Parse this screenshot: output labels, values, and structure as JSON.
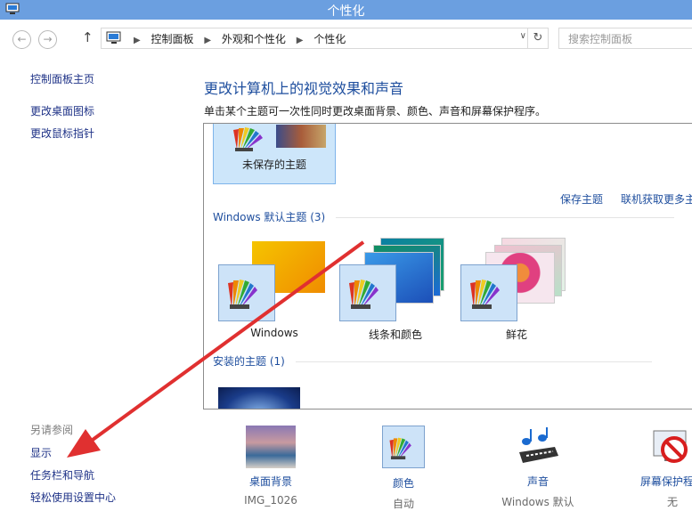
{
  "window": {
    "title": "个性化"
  },
  "nav": {
    "back": "←",
    "forward": "→",
    "up": "↑",
    "breadcrumbs": [
      "控制面板",
      "外观和个性化",
      "个性化"
    ],
    "dropdown": "∨",
    "refresh": "↻",
    "search_placeholder": "搜索控制面板"
  },
  "sidebar": {
    "links": [
      "控制面板主页",
      "更改桌面图标",
      "更改鼠标指针"
    ],
    "see_also_label": "另请参阅",
    "see_also": [
      "显示",
      "任务栏和导航",
      "轻松使用设置中心"
    ]
  },
  "main": {
    "heading": "更改计算机上的视觉效果和声音",
    "description": "单击某个主题可一次性同时更改桌面背景、颜色、声音和屏幕保护程序。",
    "unsaved_theme": "未保存的主题",
    "actions": [
      "保存主题",
      "联机获取更多主题"
    ],
    "default_group": "Windows 默认主题 (3)",
    "default_themes": [
      "Windows",
      "线条和颜色",
      "鲜花"
    ],
    "installed_group": "安装的主题 (1)"
  },
  "bottom": [
    {
      "label": "桌面背景",
      "value": "IMG_1026"
    },
    {
      "label": "颜色",
      "value": "自动"
    },
    {
      "label": "声音",
      "value": "Windows 默认"
    },
    {
      "label": "屏幕保护程序",
      "value": "无"
    }
  ],
  "colors": {
    "title_bar": "#6b9fe0",
    "link": "#1e3287",
    "heading": "#1e4e9e",
    "annotation_arrow": "#e03030"
  }
}
